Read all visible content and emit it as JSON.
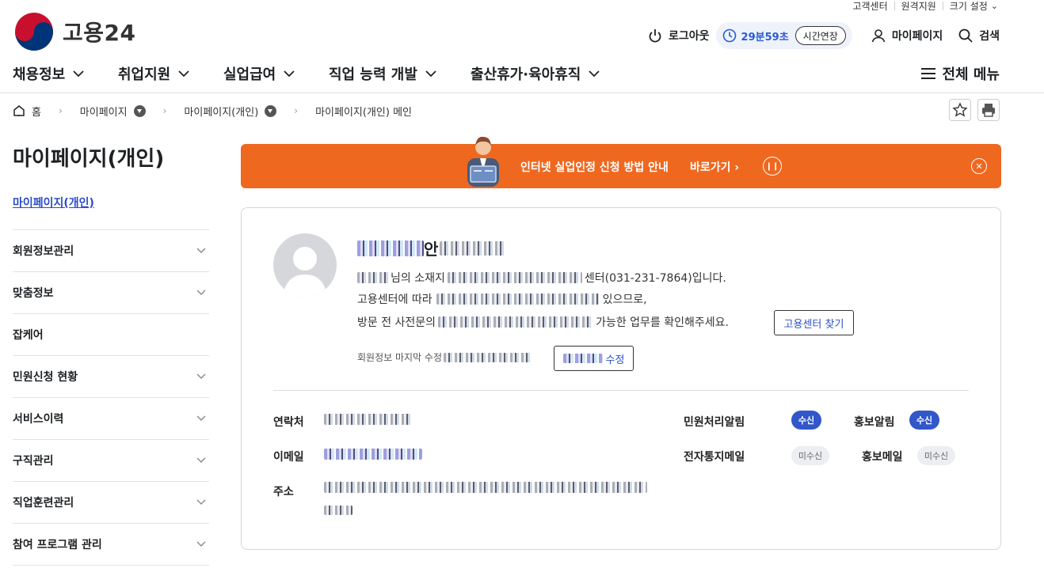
{
  "utility": {
    "customer_center": "고객센터",
    "remote_support": "원격지원",
    "font_size": "크기 설정"
  },
  "logo": {
    "text": "고용24"
  },
  "header": {
    "logout": "로그아웃",
    "timer": "29분59초",
    "extend": "시간연장",
    "mypage": "마이페이지",
    "search": "검색"
  },
  "gnb": {
    "items": [
      "채용정보",
      "취업지원",
      "실업급여",
      "직업 능력 개발",
      "출산휴가·육아휴직"
    ],
    "all_menu": "전체 메뉴"
  },
  "breadcrumb": {
    "home": "홈",
    "level1": "마이페이지",
    "level2": "마이페이지(개인)",
    "level3": "마이페이지(개인) 메인"
  },
  "sidebar": {
    "title": "마이페이지(개인)",
    "current": "마이페이지(개인)",
    "items": [
      "회원정보관리",
      "맞춤정보",
      "잡케어",
      "민원신청 현황",
      "서비스이력",
      "구직관리",
      "직업훈련관리",
      "참여 프로그램 관리"
    ]
  },
  "banner": {
    "message": "인터넷 실업인정 신청 방법 안내",
    "link": "바로가기"
  },
  "profile": {
    "greeting_suffix": "안",
    "line1_a": "님의 소재지",
    "line1_b": "센터(031-231-7864)입니다.",
    "line2_a": "고용센터에 따라",
    "line2_b": "있으므로,",
    "line3_a": "방문 전 사전문의",
    "line3_b": "가능한 업무를 확인해주세요.",
    "find_center": "고용센터 찾기",
    "last_modified": "회원정보 마지막 수정",
    "edit": "수정"
  },
  "details": {
    "contact": "연락처",
    "email": "이메일",
    "address": "주소",
    "civil_alert": "민원처리알림",
    "promo_alert": "홍보알림",
    "e_notice_mail": "전자통지메일",
    "promo_mail": "홍보메일",
    "civil_alert_state": "수신",
    "promo_alert_state": "수신",
    "e_notice_mail_state": "미수신",
    "promo_mail_state": "미수신"
  },
  "colors": {
    "accent": "#2a5ad3",
    "banner": "#ef6820",
    "badge_on": "#3157c9"
  }
}
